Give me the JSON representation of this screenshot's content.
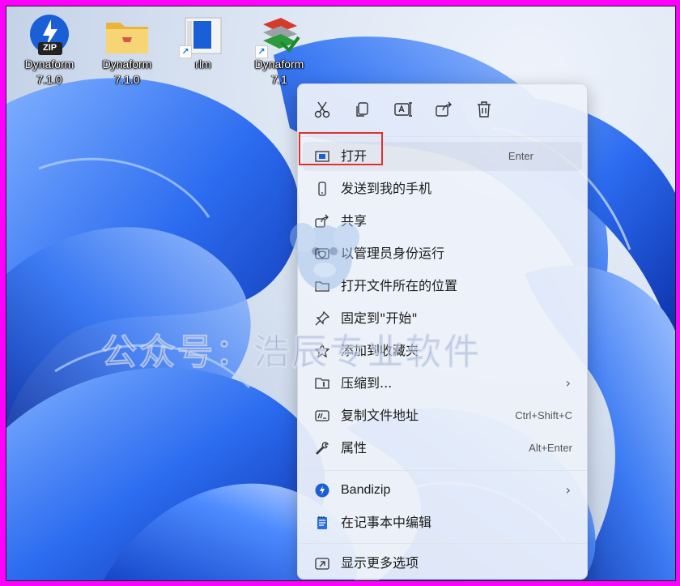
{
  "desktop": {
    "icons": [
      {
        "name": "dynaform-zip-icon",
        "line1": "Dynaform",
        "line2": "7.1.0",
        "badge": "ZIP"
      },
      {
        "name": "dynaform-folder-icon",
        "line1": "Dynaform",
        "line2": "7.1.0"
      },
      {
        "name": "rlm-icon",
        "line1": "rlm",
        "line2": ""
      },
      {
        "name": "dynaform-app-icon",
        "line1": "Dynaform",
        "line2": "7.1"
      }
    ]
  },
  "context_menu": {
    "quick_actions": [
      "cut-icon",
      "copy-icon",
      "rename-icon",
      "share-icon",
      "delete-icon"
    ],
    "items": [
      {
        "label": "打开",
        "shortcut": "Enter",
        "icon": "open-app-icon"
      },
      {
        "label": "发送到我的手机",
        "shortcut": "",
        "icon": "phone-icon"
      },
      {
        "label": "共享",
        "shortcut": "",
        "icon": "share-icon"
      },
      {
        "label": "以管理员身份运行",
        "shortcut": "",
        "icon": "shield-icon"
      },
      {
        "label": "打开文件所在的位置",
        "shortcut": "",
        "icon": "folder-icon"
      },
      {
        "label": "固定到\"开始\"",
        "shortcut": "",
        "icon": "pin-icon"
      },
      {
        "label": "添加到收藏夹",
        "shortcut": "",
        "icon": "star-icon"
      },
      {
        "label": "压缩到...",
        "shortcut": "",
        "icon": "zip-icon",
        "submenu": true
      },
      {
        "label": "复制文件地址",
        "shortcut": "Ctrl+Shift+C",
        "icon": "copy-path-icon"
      },
      {
        "label": "属性",
        "shortcut": "Alt+Enter",
        "icon": "wrench-icon"
      },
      {
        "label": "Bandizip",
        "shortcut": "",
        "icon": "bandizip-icon",
        "submenu": true
      },
      {
        "label": "在记事本中编辑",
        "shortcut": "",
        "icon": "notepad-icon"
      },
      {
        "label": "显示更多选项",
        "shortcut": "",
        "icon": "more-options-icon"
      }
    ],
    "submenu_arrow": "›"
  },
  "watermark": "公众号：浩辰专业软件",
  "colors": {
    "frame": "#ff00ff",
    "highlight": "#e03030",
    "accent": "#1a5fd6"
  }
}
